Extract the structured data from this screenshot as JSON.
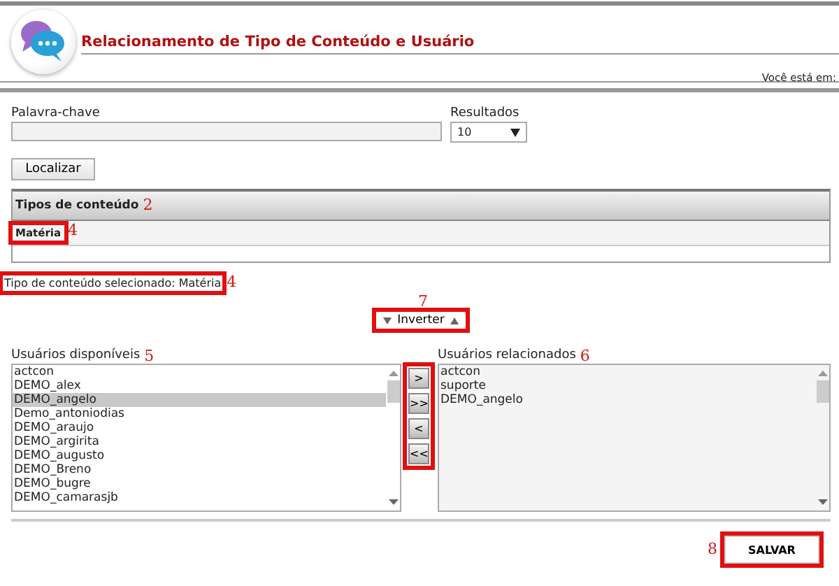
{
  "header": {
    "title": "Relacionamento de Tipo de Conteúdo e Usuário",
    "breadcrumb_label": "Você está em:"
  },
  "search": {
    "keyword_label": "Palavra-chave",
    "results_label": "Resultados",
    "results_value": "10",
    "find_button": "Localizar"
  },
  "content_types": {
    "heading": "Tipos de conteúdo",
    "heading_callout": "2",
    "rows": [
      {
        "label": "Matéria",
        "selected": true,
        "highlighted": true,
        "callout": "4"
      }
    ]
  },
  "selected_type": {
    "text": "Tipo de conteúdo selecionado: Matéria",
    "highlighted": true,
    "callout": "4"
  },
  "invert": {
    "label": "Inverter",
    "highlighted": true,
    "callout": "7"
  },
  "available_users": {
    "label": "Usuários disponíveis",
    "callout": "5",
    "items": [
      {
        "name": "actcon",
        "selected": false
      },
      {
        "name": "DEMO_alex",
        "selected": false
      },
      {
        "name": "DEMO_angelo",
        "selected": true
      },
      {
        "name": "Demo_antoniodias",
        "selected": false
      },
      {
        "name": "DEMO_araujo",
        "selected": false
      },
      {
        "name": "DEMO_argirita",
        "selected": false
      },
      {
        "name": "DEMO_augusto",
        "selected": false
      },
      {
        "name": "DEMO_Breno",
        "selected": false
      },
      {
        "name": "DEMO_bugre",
        "selected": false
      },
      {
        "name": "DEMO_camarasjb",
        "selected": false
      }
    ]
  },
  "transfer_buttons": {
    "labels": [
      ">",
      ">>",
      "<",
      "<<"
    ],
    "highlighted": true
  },
  "related_users": {
    "label": "Usuários relacionados",
    "callout": "6",
    "items": [
      {
        "name": "actcon",
        "selected": false
      },
      {
        "name": "suporte",
        "selected": false
      },
      {
        "name": "DEMO_angelo",
        "selected": false
      }
    ]
  },
  "save": {
    "label": "SALVAR",
    "highlighted": true,
    "callout": "8"
  }
}
